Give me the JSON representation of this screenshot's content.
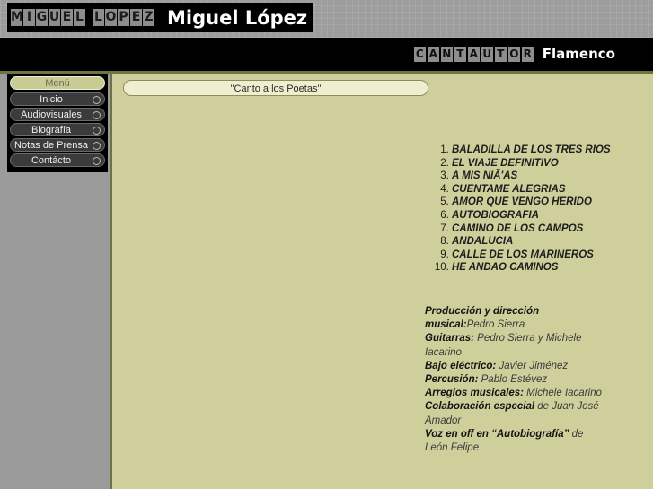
{
  "header": {
    "logo_letters": [
      "M",
      "I",
      "G",
      "U",
      "E",
      "L",
      "L",
      "O",
      "P",
      "E",
      "Z"
    ],
    "logo_word1": "MIGUEL",
    "logo_word2": "LOPEZ",
    "site_name": "Miguel López",
    "tagline_letters": [
      "C",
      "A",
      "N",
      "T",
      "A",
      "U",
      "T",
      "O",
      "R"
    ],
    "tagline_word": "CANTAUTOR",
    "tagline_suffix": "Flamenco"
  },
  "menu": {
    "title": "Menú",
    "items": [
      {
        "label": "Inicio"
      },
      {
        "label": "Audiovisuales"
      },
      {
        "label": "Biografía"
      },
      {
        "label": "Notas de Prensa"
      },
      {
        "label": "Contácto"
      }
    ]
  },
  "main": {
    "album_title": "\"Canto a los Poetas\"",
    "tracks": [
      "BALADILLA DE LOS TRES RIOS",
      "EL VIAJE DEFINITIVO",
      "A MIS NIÃ'AS",
      "CUENTAME ALEGRIAS",
      "AMOR QUE VENGO HERIDO",
      "AUTOBIOGRAFIA",
      "CAMINO DE LOS CAMPOS",
      "ANDALUCIA",
      "CALLE DE LOS MARINEROS",
      "HE ANDAO CAMINOS"
    ],
    "credits": [
      {
        "label": "Producción y dirección musical:",
        "value": "Pedro Sierra"
      },
      {
        "label": "Guitarras:",
        "value": " Pedro Sierra y Michele Iacarino"
      },
      {
        "label": "Bajo eléctrico:",
        "value": " Javier Jiménez"
      },
      {
        "label": "Percusión:",
        "value": " Pablo Estévez"
      },
      {
        "label": "Arreglos musicales:",
        "value": " Michele Iacarino"
      },
      {
        "label": "Colaboración especial",
        "value": " de Juan José Amador"
      },
      {
        "label": "Voz en off en “Autobiografía”",
        "value": " de León Felipe"
      }
    ]
  },
  "colors": {
    "content_bg": "#cfcf9c",
    "rule": "#6f7344",
    "gray": "#9b9b9b",
    "black": "#000000",
    "menu_title_bg": "#c9cb94"
  }
}
